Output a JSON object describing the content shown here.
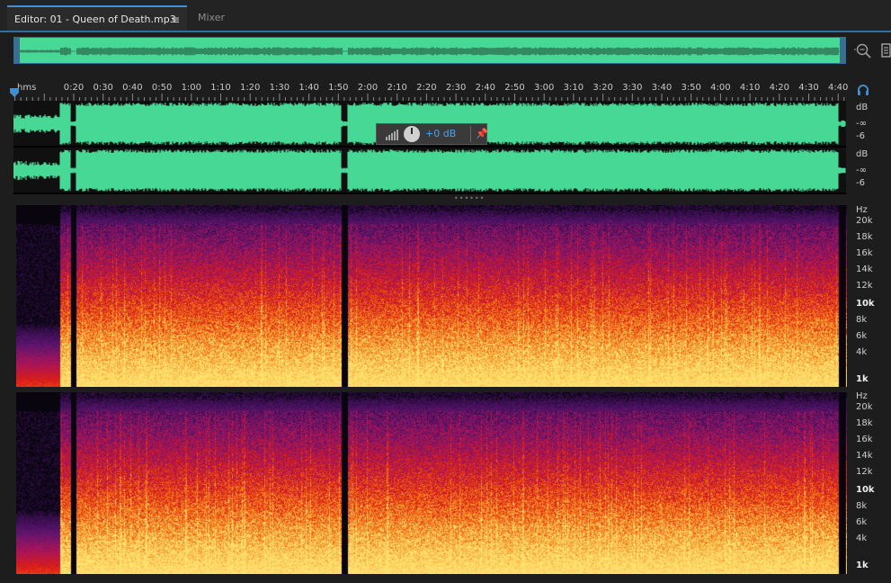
{
  "tabs": {
    "editor_label": "Editor: 01 - Queen of Death.mp3",
    "editor_menu": "≡",
    "mixer_label": "Mixer"
  },
  "timeline": {
    "unit": "hms",
    "ticks": [
      "0:20",
      "0:30",
      "0:40",
      "0:50",
      "1:00",
      "1:10",
      "1:20",
      "1:30",
      "1:40",
      "1:50",
      "2:00",
      "2:10",
      "2:20",
      "2:30",
      "2:40",
      "2:50",
      "3:00",
      "3:10",
      "3:20",
      "3:30",
      "3:40",
      "3:50",
      "4:00",
      "4:10",
      "4:20",
      "4:30",
      "4:40"
    ]
  },
  "waveform": {
    "channel1_scale": [
      "dB",
      "-∞",
      "-6"
    ],
    "channel2_scale": [
      "dB",
      "-∞",
      "-6"
    ],
    "color": "#47d896"
  },
  "hud": {
    "gain_value": "+0 dB"
  },
  "spectral": {
    "channel1_scale": [
      "Hz",
      "20k",
      "18k",
      "16k",
      "14k",
      "12k",
      "10k",
      "8k",
      "6k",
      "4k",
      "1k"
    ],
    "channel2_scale": [
      "Hz",
      "20k",
      "18k",
      "16k",
      "14k",
      "12k",
      "10k",
      "8k",
      "6k",
      "4k",
      "1k"
    ]
  },
  "colors": {
    "accent": "#2f6f9e",
    "hud_value": "#4aa3e8"
  }
}
